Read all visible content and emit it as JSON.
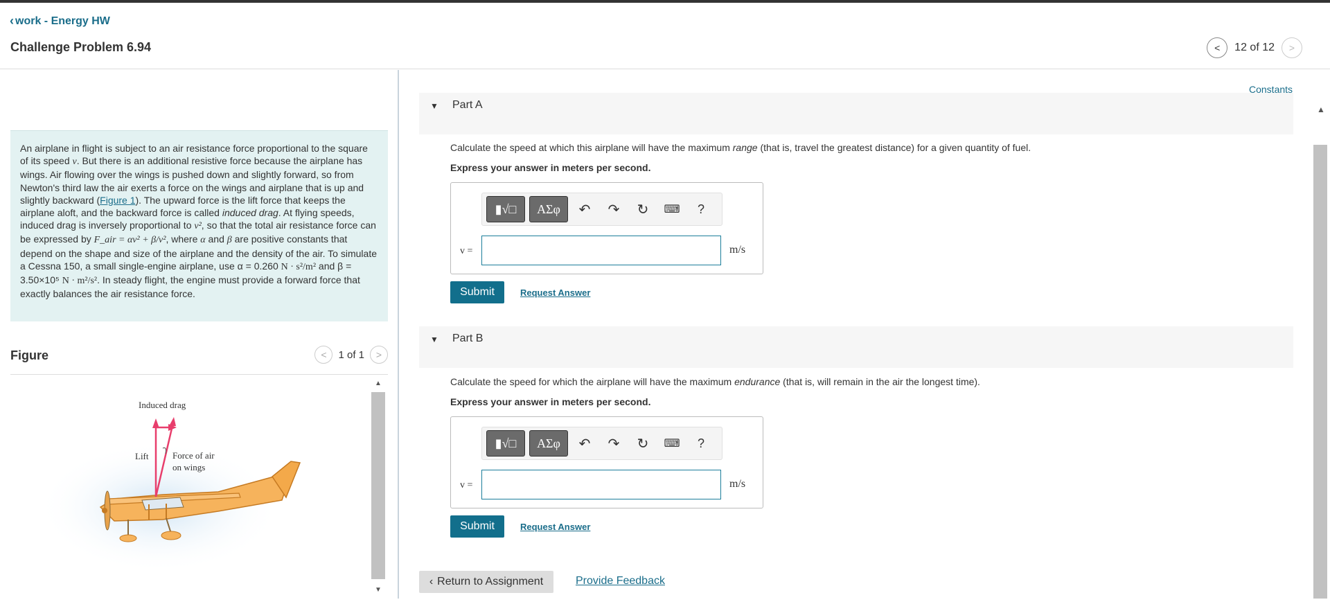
{
  "header": {
    "back_label": "work - Energy HW",
    "title": "Challenge Problem 6.94",
    "pager_text": "12 of 12"
  },
  "intro": {
    "text_1": "An airplane in flight is subject to an air resistance force proportional to the square of its speed ",
    "text_2": ". But there is an additional resistive force because the airplane has wings. Air flowing over the wings is pushed down and slightly forward, so from Newton's third law the air exerts a force on the wings and airplane that is up and slightly backward (",
    "figure_link": "Figure 1",
    "text_3": "). The upward force is the lift force that keeps the airplane aloft, and the backward force is called ",
    "induced_drag": "induced drag",
    "text_4": ". At flying speeds, induced drag is inversely proportional to ",
    "text_5": ", so that the total air resistance force can be expressed by ",
    "text_6": ", where ",
    "text_7": " and ",
    "text_8": " are positive constants that depend on the shape and size of the airplane and the density of the air. To simulate a Cessna 150, a small single-engine airplane, use ",
    "alpha_value": "α = 0.260",
    "alpha_unit": "N · s²/m²",
    "text_9": " and ",
    "beta_value": "β = 3.50×10⁵",
    "beta_unit": "N · m²/s²",
    "text_10": ". In steady flight, the engine must provide a forward force that exactly balances the air resistance force.",
    "sym_v": "v",
    "sym_v2": "v²",
    "formula": "F_air = αv² + β/v²",
    "sym_alpha": "α",
    "sym_beta": "β"
  },
  "figure": {
    "title": "Figure",
    "pager_text": "1 of 1",
    "label_induced_drag": "Induced drag",
    "label_lift": "Lift",
    "label_force_1": "Force of air",
    "label_force_2": "on wings"
  },
  "constants_label": "Constants",
  "parts": [
    {
      "title": "Part A",
      "question_1": "Calculate the speed at which this airplane will have the maximum ",
      "question_em": "range",
      "question_2": " (that is, travel the greatest distance) for a given quantity of fuel.",
      "express": "Express your answer in meters per second.",
      "var_label": "v =",
      "unit": "m/s",
      "submit": "Submit",
      "request": "Request Answer"
    },
    {
      "title": "Part B",
      "question_1": "Calculate the speed for which the airplane will have the maximum ",
      "question_em": "endurance",
      "question_2": " (that is, will remain in the air the longest time).",
      "express": "Express your answer in meters per second.",
      "var_label": "v =",
      "unit": "m/s",
      "submit": "Submit",
      "request": "Request Answer"
    }
  ],
  "toolbar": {
    "templates_label": "▮√□",
    "greek_label": "ΑΣφ",
    "help_label": "?"
  },
  "footer": {
    "return_label": "Return to Assignment",
    "feedback_label": "Provide Feedback"
  }
}
